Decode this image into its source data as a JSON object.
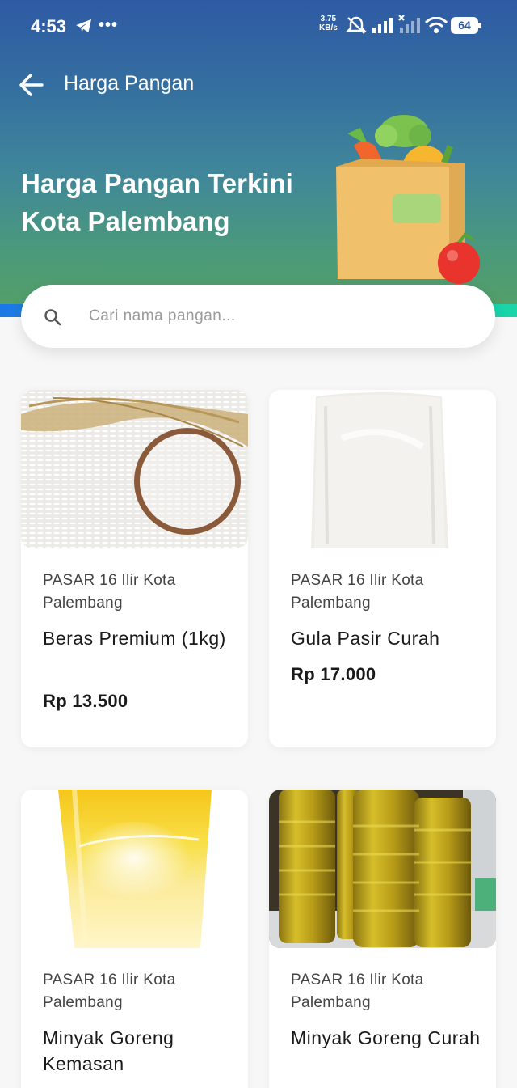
{
  "status_bar": {
    "time": "4:53",
    "net_speed_value": "3.75",
    "net_speed_unit": "KB/s",
    "battery": "64",
    "icons": [
      "telegram-icon",
      "more-icon",
      "mute-icon",
      "signal-icon",
      "signal-off-icon",
      "wifi-icon",
      "battery-icon"
    ]
  },
  "app_bar": {
    "title": "Harga Pangan",
    "back_icon": "arrow-left-icon"
  },
  "hero": {
    "title": "Harga Pangan Terkini Kota Palembang",
    "illustration": "grocery-bag-illustration"
  },
  "search": {
    "placeholder": "Cari nama pangan...",
    "value": "",
    "icon": "search-icon"
  },
  "colors": {
    "header_top": "#2e5aa4",
    "header_bottom": "#55a165",
    "card_bg": "#ffffff",
    "page_bg": "#f7f7f7"
  },
  "products": [
    {
      "market": "PASAR 16 Ilir Kota Palembang",
      "name": "Beras Premium (1kg)",
      "price": "Rp 13.500",
      "image": "rice-bowl-photo"
    },
    {
      "market": "PASAR 16 Ilir Kota Palembang",
      "name": "Gula Pasir Curah",
      "price": "Rp 17.000",
      "image": "sugar-bag-photo"
    },
    {
      "market": "PASAR 16 Ilir Kota Palembang",
      "name": "Minyak Goreng Kemasan",
      "price": "",
      "image": "cooking-oil-glass-photo"
    },
    {
      "market": "PASAR 16 Ilir Kota Palembang",
      "name": "Minyak Goreng Curah",
      "price": "",
      "image": "cooking-oil-bottles-photo"
    }
  ]
}
